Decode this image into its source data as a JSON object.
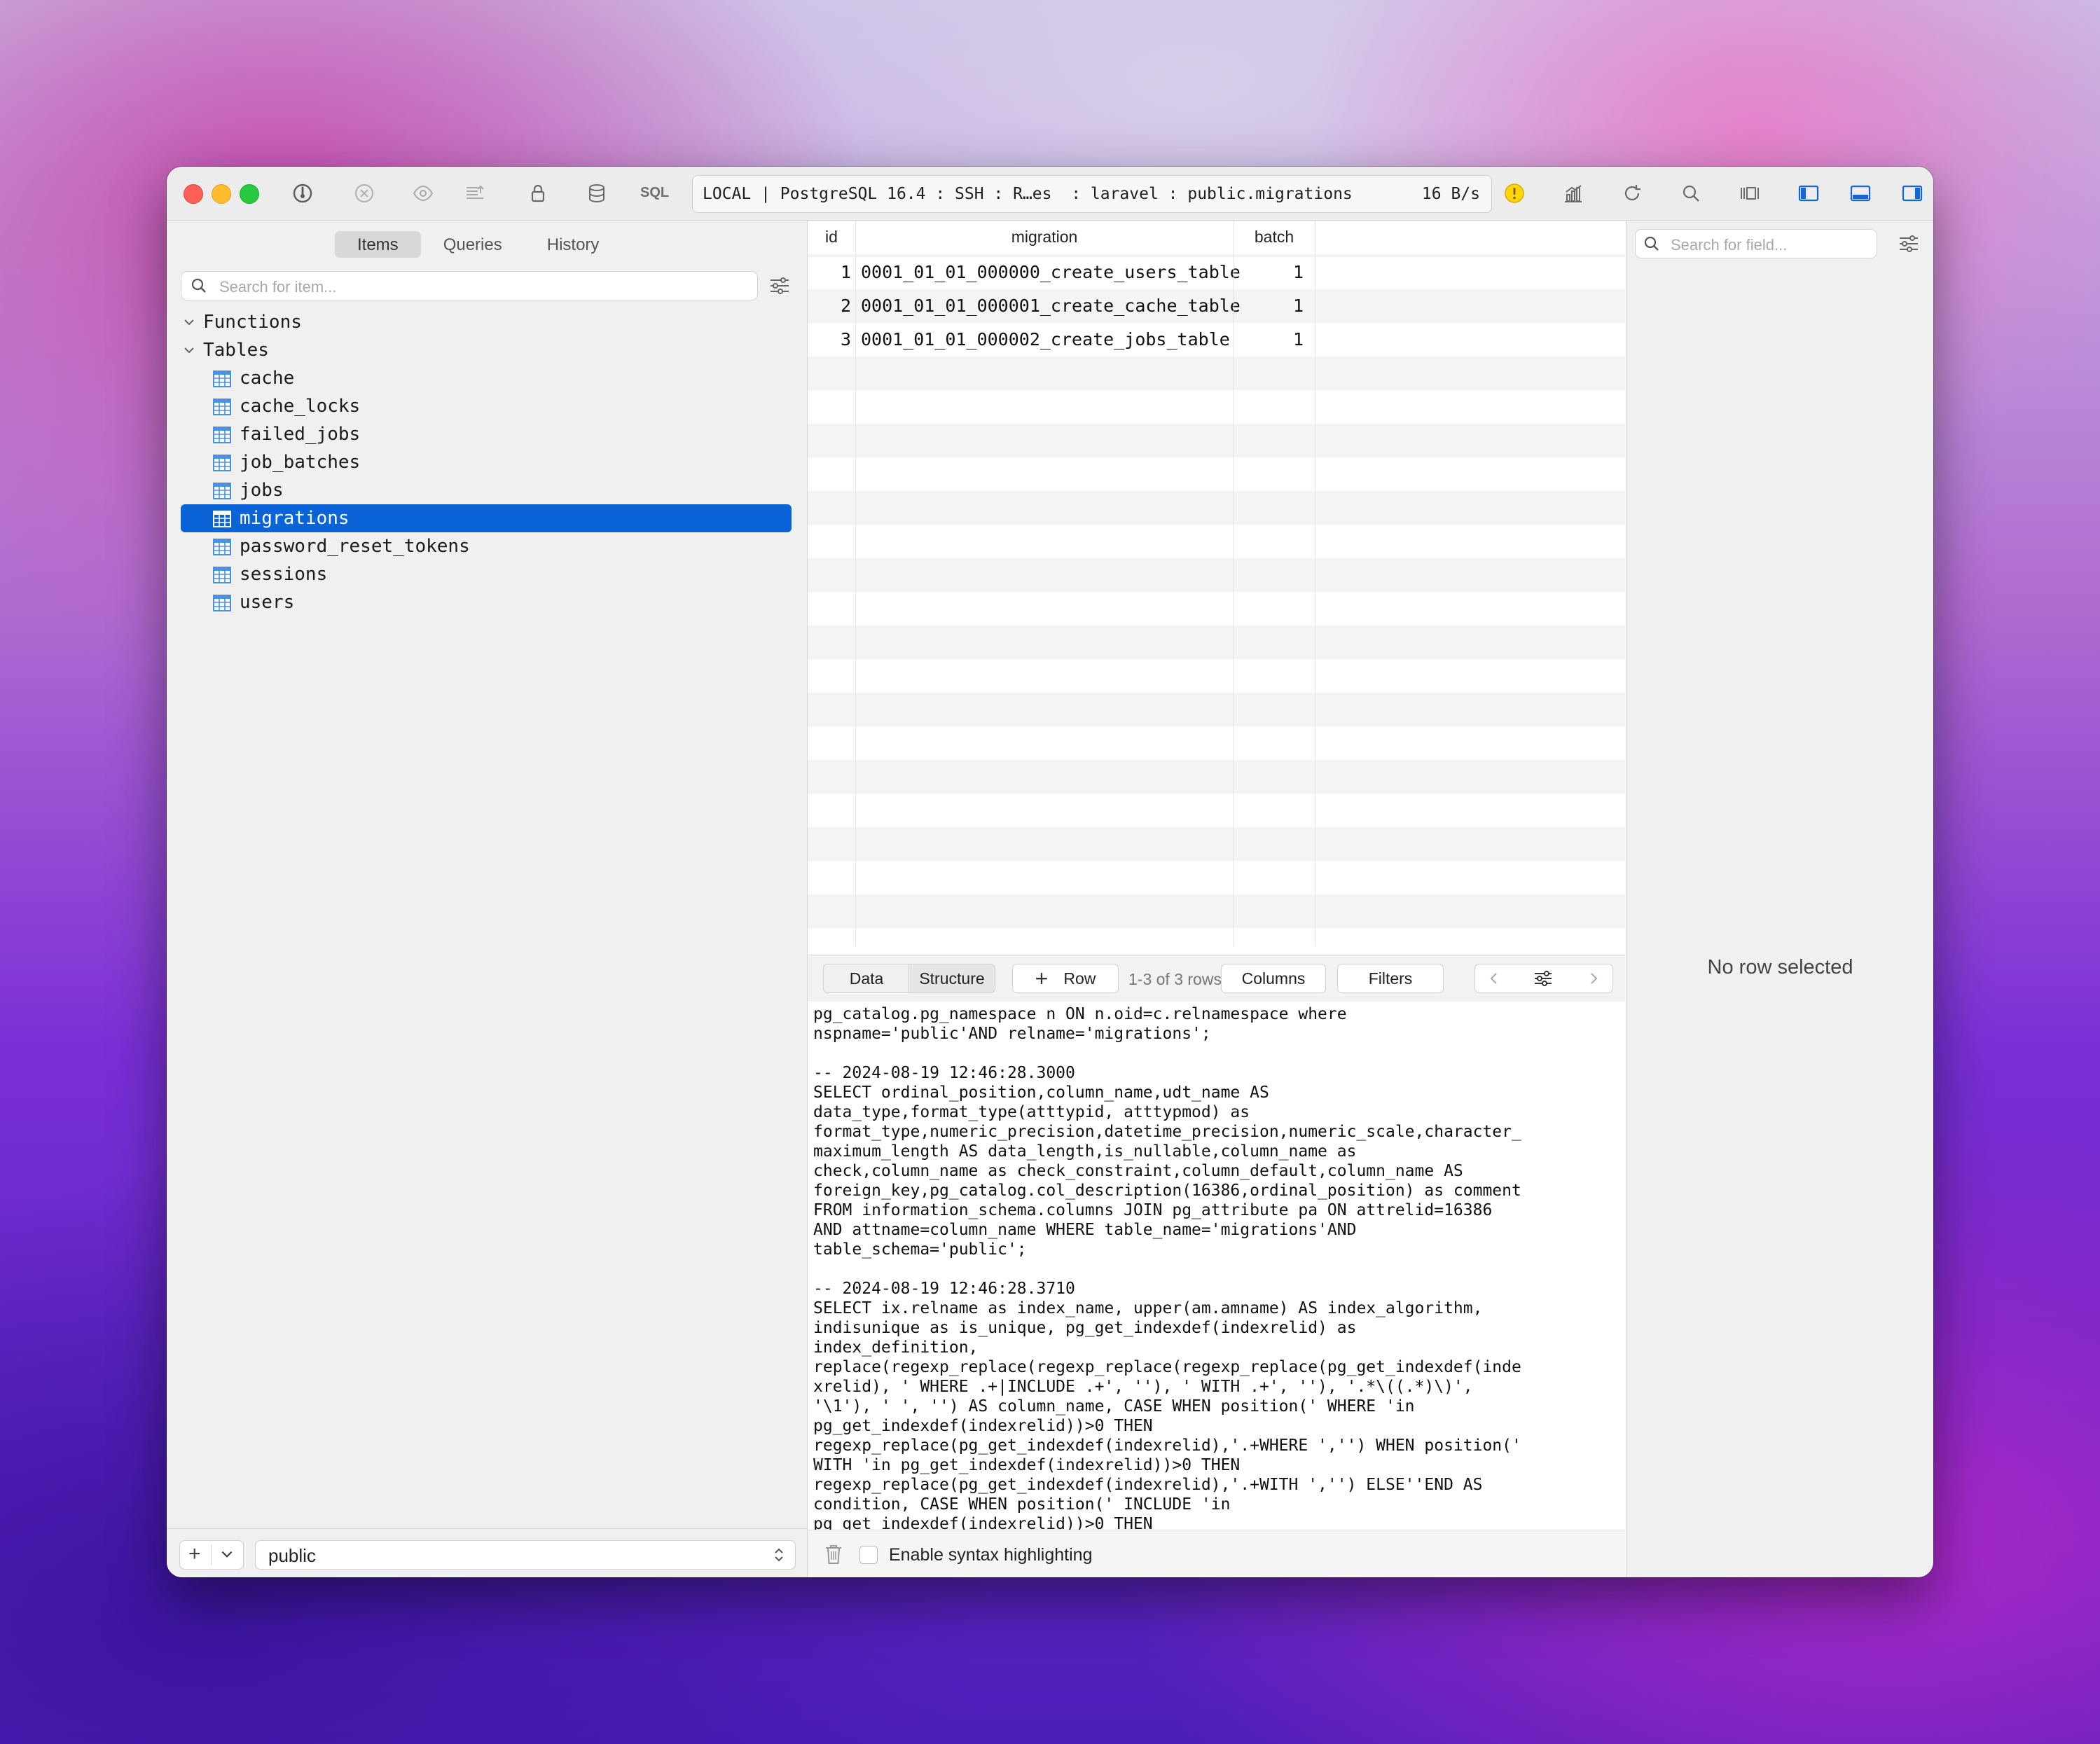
{
  "toolbar": {
    "sql_label": "SQL",
    "connection": "LOCAL | PostgreSQL 16.4 : SSH : R…es  : laravel : public.migrations",
    "speed": "16 B/s"
  },
  "sidebar": {
    "tabs": [
      {
        "label": "Items",
        "active": true
      },
      {
        "label": "Queries",
        "active": false
      },
      {
        "label": "History",
        "active": false
      }
    ],
    "search_placeholder": "Search for item...",
    "groups": [
      {
        "label": "Functions"
      },
      {
        "label": "Tables"
      }
    ],
    "tables": [
      "cache",
      "cache_locks",
      "failed_jobs",
      "job_batches",
      "jobs",
      "migrations",
      "password_reset_tokens",
      "sessions",
      "users"
    ],
    "selected_table": "migrations",
    "schema": "public"
  },
  "grid": {
    "columns": [
      "id",
      "migration",
      "batch"
    ],
    "rows": [
      {
        "id": "1",
        "migration": "0001_01_01_000000_create_users_table",
        "batch": "1"
      },
      {
        "id": "2",
        "migration": "0001_01_01_000001_create_cache_table",
        "batch": "1"
      },
      {
        "id": "3",
        "migration": "0001_01_01_000002_create_jobs_table",
        "batch": "1"
      }
    ],
    "toolbar": {
      "data_tab": "Data",
      "structure_tab": "Structure",
      "row_button": "Row",
      "rows_info": "1-3 of 3 rows",
      "columns_button": "Columns",
      "filters_button": "Filters"
    }
  },
  "log": {
    "text": "pg_catalog.pg_namespace n ON n.oid=c.relnamespace where\nnspname='public'AND relname='migrations';\n\n-- 2024-08-19 12:46:28.3000\nSELECT ordinal_position,column_name,udt_name AS\ndata_type,format_type(atttypid, atttypmod) as\nformat_type,numeric_precision,datetime_precision,numeric_scale,character_\nmaximum_length AS data_length,is_nullable,column_name as\ncheck,column_name as check_constraint,column_default,column_name AS\nforeign_key,pg_catalog.col_description(16386,ordinal_position) as comment\nFROM information_schema.columns JOIN pg_attribute pa ON attrelid=16386\nAND attname=column_name WHERE table_name='migrations'AND\ntable_schema='public';\n\n-- 2024-08-19 12:46:28.3710\nSELECT ix.relname as index_name, upper(am.amname) AS index_algorithm,\nindisunique as is_unique, pg_get_indexdef(indexrelid) as\nindex_definition,\nreplace(regexp_replace(regexp_replace(regexp_replace(pg_get_indexdef(inde\nxrelid), ' WHERE .+|INCLUDE .+', ''), ' WITH .+', ''), '.*\\((.*)\\)',\n'\\1'), ' ', '') AS column_name, CASE WHEN position(' WHERE 'in\npg_get_indexdef(indexrelid))>0 THEN\nregexp_replace(pg_get_indexdef(indexrelid),'.+WHERE ','') WHEN position('\nWITH 'in pg_get_indexdef(indexrelid))>0 THEN\nregexp_replace(pg_get_indexdef(indexrelid),'.+WITH ','') ELSE''END AS\ncondition, CASE WHEN position(' INCLUDE 'in\npg_get_indexdef(indexrelid))>0 THEN\nregexp_replace(pg_get_indexdef(indexrelid),'.+INCLUDE ','') WHEN\nposition(' WITH 'in pg_get_indexdef(indexrelid))>0 THEN\nregexp_replace(pg_get_indexdef(indexrelid),'.+WITH ','') ELSE''END AS\ninclude, pg_catalog.obj_description(i.indexrelid,'pg_class')as comment\nFROM pg_index i JOIN pg_class t ON t.oid = i.indrelid JOIN pg_class ix ON\nix.oid = i.indexrelid JOIN pg_namespace n ON t.relnamespace = n.oid JOIN\npg_am as am ON ix.relam = am.oid WHERE t.relname = 'migrations' AND\nn.nspname = 'public';",
    "syntax_label": "Enable syntax highlighting",
    "syntax_enabled": false
  },
  "right_panel": {
    "search_placeholder": "Search for field...",
    "empty_text": "No row selected"
  }
}
